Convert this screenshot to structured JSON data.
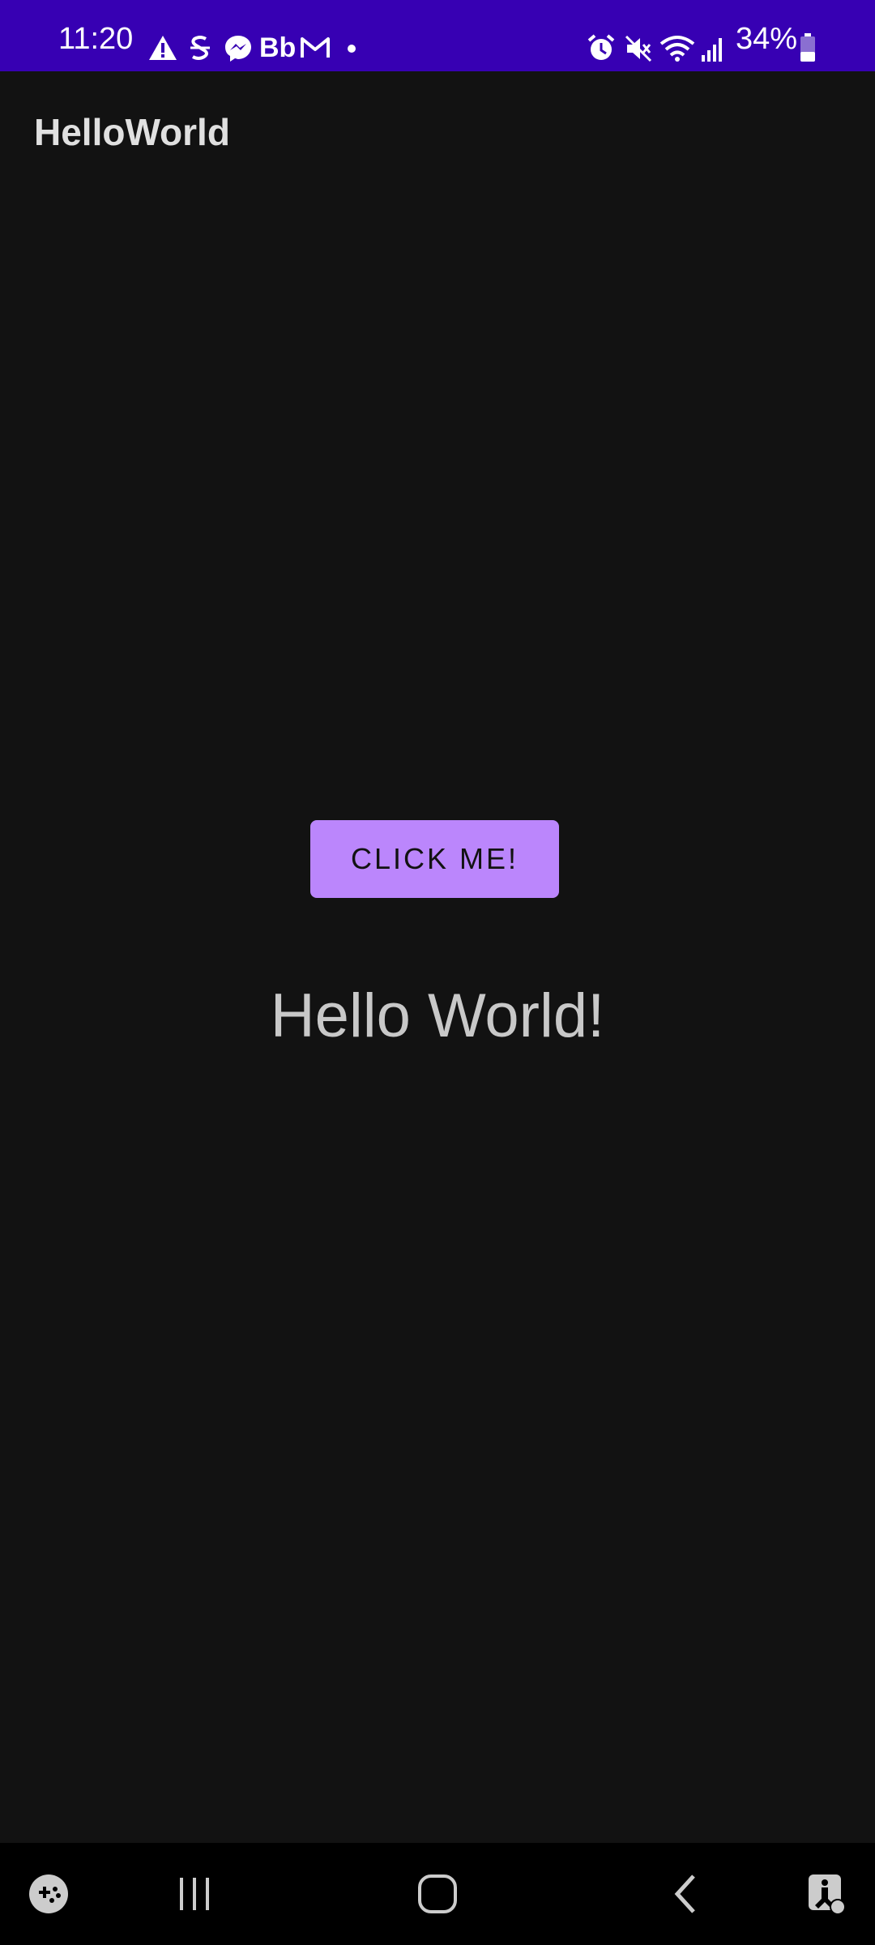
{
  "status_bar": {
    "time": "11:20",
    "battery": "34%",
    "left_icons": [
      "warning-icon",
      "samsung-s-icon",
      "messenger-icon",
      "bb-icon",
      "gmail-icon",
      "dot-icon"
    ],
    "right_icons": [
      "alarm-icon",
      "mute-icon",
      "wifi-icon",
      "signal-icon",
      "battery-icon"
    ],
    "bb_label": "Bb"
  },
  "app_bar": {
    "title": "HelloWorld"
  },
  "main": {
    "button_label": "CLICK ME!",
    "message": "Hello World!"
  },
  "nav_bar": {
    "items": [
      "game-launcher-icon",
      "recents-icon",
      "home-icon",
      "back-icon",
      "accessibility-icon"
    ]
  },
  "colors": {
    "status_bar": "#3700b3",
    "background": "#121212",
    "button": "#bb86fc",
    "nav_bar": "#000000"
  }
}
